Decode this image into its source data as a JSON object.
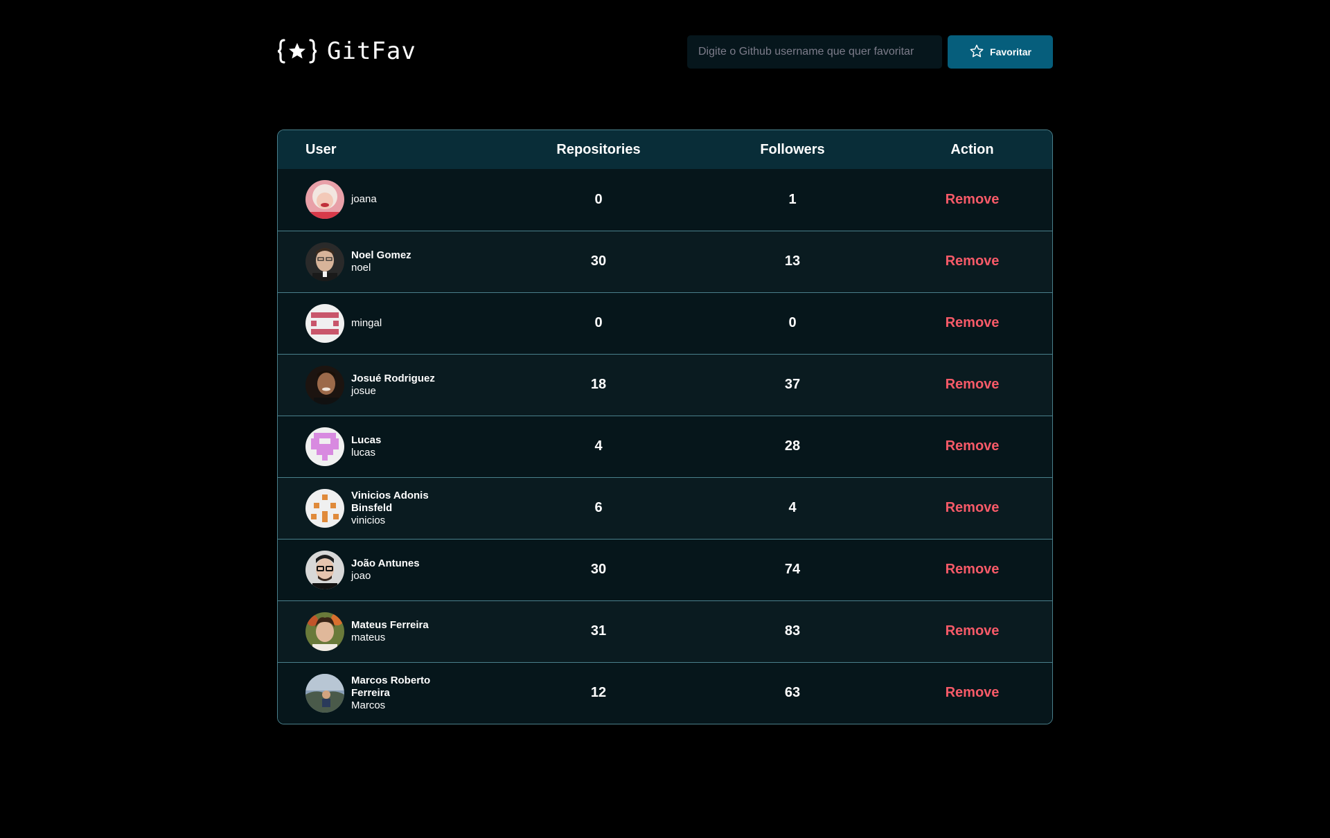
{
  "app": {
    "title": "GitFav"
  },
  "search": {
    "placeholder": "Digite o Github username que quer favoritar",
    "value": "",
    "button_label": "Favoritar"
  },
  "table": {
    "headers": {
      "user": "User",
      "repositories": "Repositories",
      "followers": "Followers",
      "action": "Action"
    },
    "rows": [
      {
        "name": "",
        "login": "joana",
        "repositories": "0",
        "followers": "1",
        "action": "Remove",
        "avatar": "photo-avatar"
      },
      {
        "name": "Noel Gomez",
        "login": "noel",
        "repositories": "30",
        "followers": "13",
        "action": "Remove",
        "avatar": "photo-avatar"
      },
      {
        "name": "",
        "login": "mingal",
        "repositories": "0",
        "followers": "0",
        "action": "Remove",
        "avatar": "identicon-avatar"
      },
      {
        "name": "Josué Rodriguez",
        "login": "josue",
        "repositories": "18",
        "followers": "37",
        "action": "Remove",
        "avatar": "photo-avatar"
      },
      {
        "name": "Lucas",
        "login": "lucas",
        "repositories": "4",
        "followers": "28",
        "action": "Remove",
        "avatar": "identicon-avatar"
      },
      {
        "name": "Vinicios Adonis Binsfeld",
        "login": "vinicios",
        "repositories": "6",
        "followers": "4",
        "action": "Remove",
        "avatar": "identicon-avatar"
      },
      {
        "name": "João Antunes",
        "login": "joao",
        "repositories": "30",
        "followers": "74",
        "action": "Remove",
        "avatar": "photo-avatar"
      },
      {
        "name": "Mateus Ferreira",
        "login": "mateus",
        "repositories": "31",
        "followers": "83",
        "action": "Remove",
        "avatar": "photo-avatar"
      },
      {
        "name": "Marcos Roberto Ferreira",
        "login": "Marcos",
        "repositories": "12",
        "followers": "63",
        "action": "Remove",
        "avatar": "photo-avatar"
      }
    ]
  },
  "colors": {
    "background": "#000000",
    "header_row": "#092d38",
    "row_odd": "#06161b",
    "row_even": "#0a1b20",
    "border": "#4a808c",
    "button": "#065e7c",
    "remove": "#f75a68",
    "input_bg": "#06161c"
  },
  "icons": {
    "logo": "star-braces-icon",
    "favorite_button": "star-outline-icon"
  }
}
